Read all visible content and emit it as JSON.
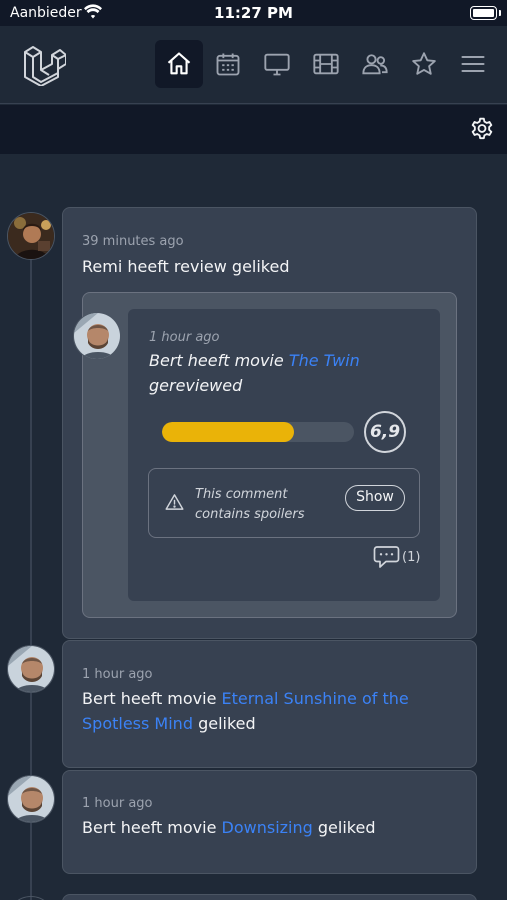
{
  "status_bar": {
    "carrier": "Aanbieder",
    "time": "11:27 PM"
  },
  "nav": {
    "items": [
      {
        "icon": "home-icon",
        "active": true
      },
      {
        "icon": "calendar-icon",
        "active": false
      },
      {
        "icon": "tv-icon",
        "active": false
      },
      {
        "icon": "film-icon",
        "active": false
      },
      {
        "icon": "users-icon",
        "active": false
      },
      {
        "icon": "star-icon",
        "active": false
      },
      {
        "icon": "menu-icon",
        "active": false
      }
    ]
  },
  "feed": [
    {
      "time": "39 minutes ago",
      "user": "Remi",
      "text": "heeft review geliked",
      "review": {
        "time": "1 hour ago",
        "user": "Bert",
        "prefix": "heeft movie",
        "movie": "The Twin",
        "suffix": "gereviewed",
        "rating_fraction": 0.69,
        "rating_label": "6,9",
        "spoiler_text": "This comment contains spoilers",
        "show_label": "Show",
        "comment_count": "(1)"
      }
    },
    {
      "time": "1 hour ago",
      "user": "Bert",
      "prefix": "heeft movie",
      "movie": "Eternal Sunshine of the Spotless Mind",
      "suffix": "geliked"
    },
    {
      "time": "1 hour ago",
      "user": "Bert",
      "prefix": "heeft movie",
      "movie": "Downsizing",
      "suffix": "geliked"
    }
  ],
  "colors": {
    "accent": "#3b82f6",
    "rating": "#eab308",
    "background": "#1f2937"
  }
}
